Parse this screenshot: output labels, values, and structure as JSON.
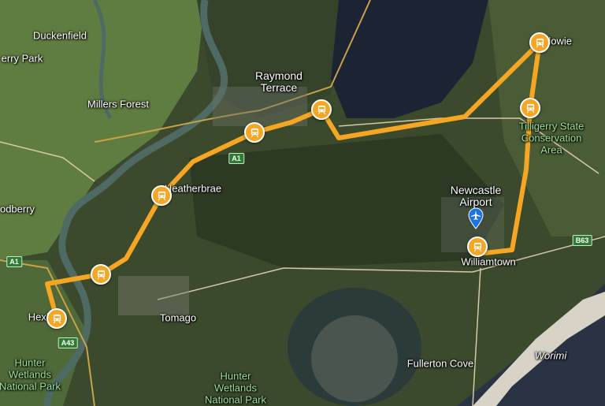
{
  "map": {
    "colors": {
      "route": "#f6a623",
      "land": "#3b4a2c",
      "water": "#1c2333",
      "river": "#4f6a63",
      "farmland": "#5f7d40",
      "pin": "#1a73e8"
    },
    "places": [
      {
        "id": "duckenfield",
        "label": "Duckenfield"
      },
      {
        "id": "berry-park",
        "label": "erry Park"
      },
      {
        "id": "millers-forest",
        "label": "Millers Forest"
      },
      {
        "id": "raymond-terrace",
        "label": "Raymond\nTerrace"
      },
      {
        "id": "medowie",
        "label": "Medowie"
      },
      {
        "id": "tilligerry",
        "label": "Tilligerry State\nConservation\nArea"
      },
      {
        "id": "heatherbrae",
        "label": "Heatherbrae"
      },
      {
        "id": "newcastle-airport",
        "label": "Newcastle\nAirport"
      },
      {
        "id": "williamtown",
        "label": "Williamtown"
      },
      {
        "id": "woodberry",
        "label": "odberry"
      },
      {
        "id": "hexham",
        "label": "Hexham"
      },
      {
        "id": "tomago",
        "label": "Tomago"
      },
      {
        "id": "hunter-wetlands-np",
        "label": "Hunter\nWetlands\nNational Park"
      },
      {
        "id": "hunter-wetlands",
        "label": "Hunter\nWetlands\nNational Park"
      },
      {
        "id": "fullerton-cove",
        "label": "Fullerton Cove"
      },
      {
        "id": "worimi",
        "label": "Worimi"
      }
    ],
    "road_shields": [
      {
        "id": "a1-north",
        "label": "A1"
      },
      {
        "id": "a1-west",
        "label": "A1"
      },
      {
        "id": "a43",
        "label": "A43"
      },
      {
        "id": "b63",
        "label": "B63"
      }
    ],
    "stops": [
      {
        "id": "hexham"
      },
      {
        "id": "tomago-west"
      },
      {
        "id": "heatherbrae"
      },
      {
        "id": "raymond-south"
      },
      {
        "id": "raymond-terrace"
      },
      {
        "id": "medowie"
      },
      {
        "id": "tilligerry"
      },
      {
        "id": "williamtown"
      }
    ],
    "airport_icon": "airport-pin-icon"
  }
}
